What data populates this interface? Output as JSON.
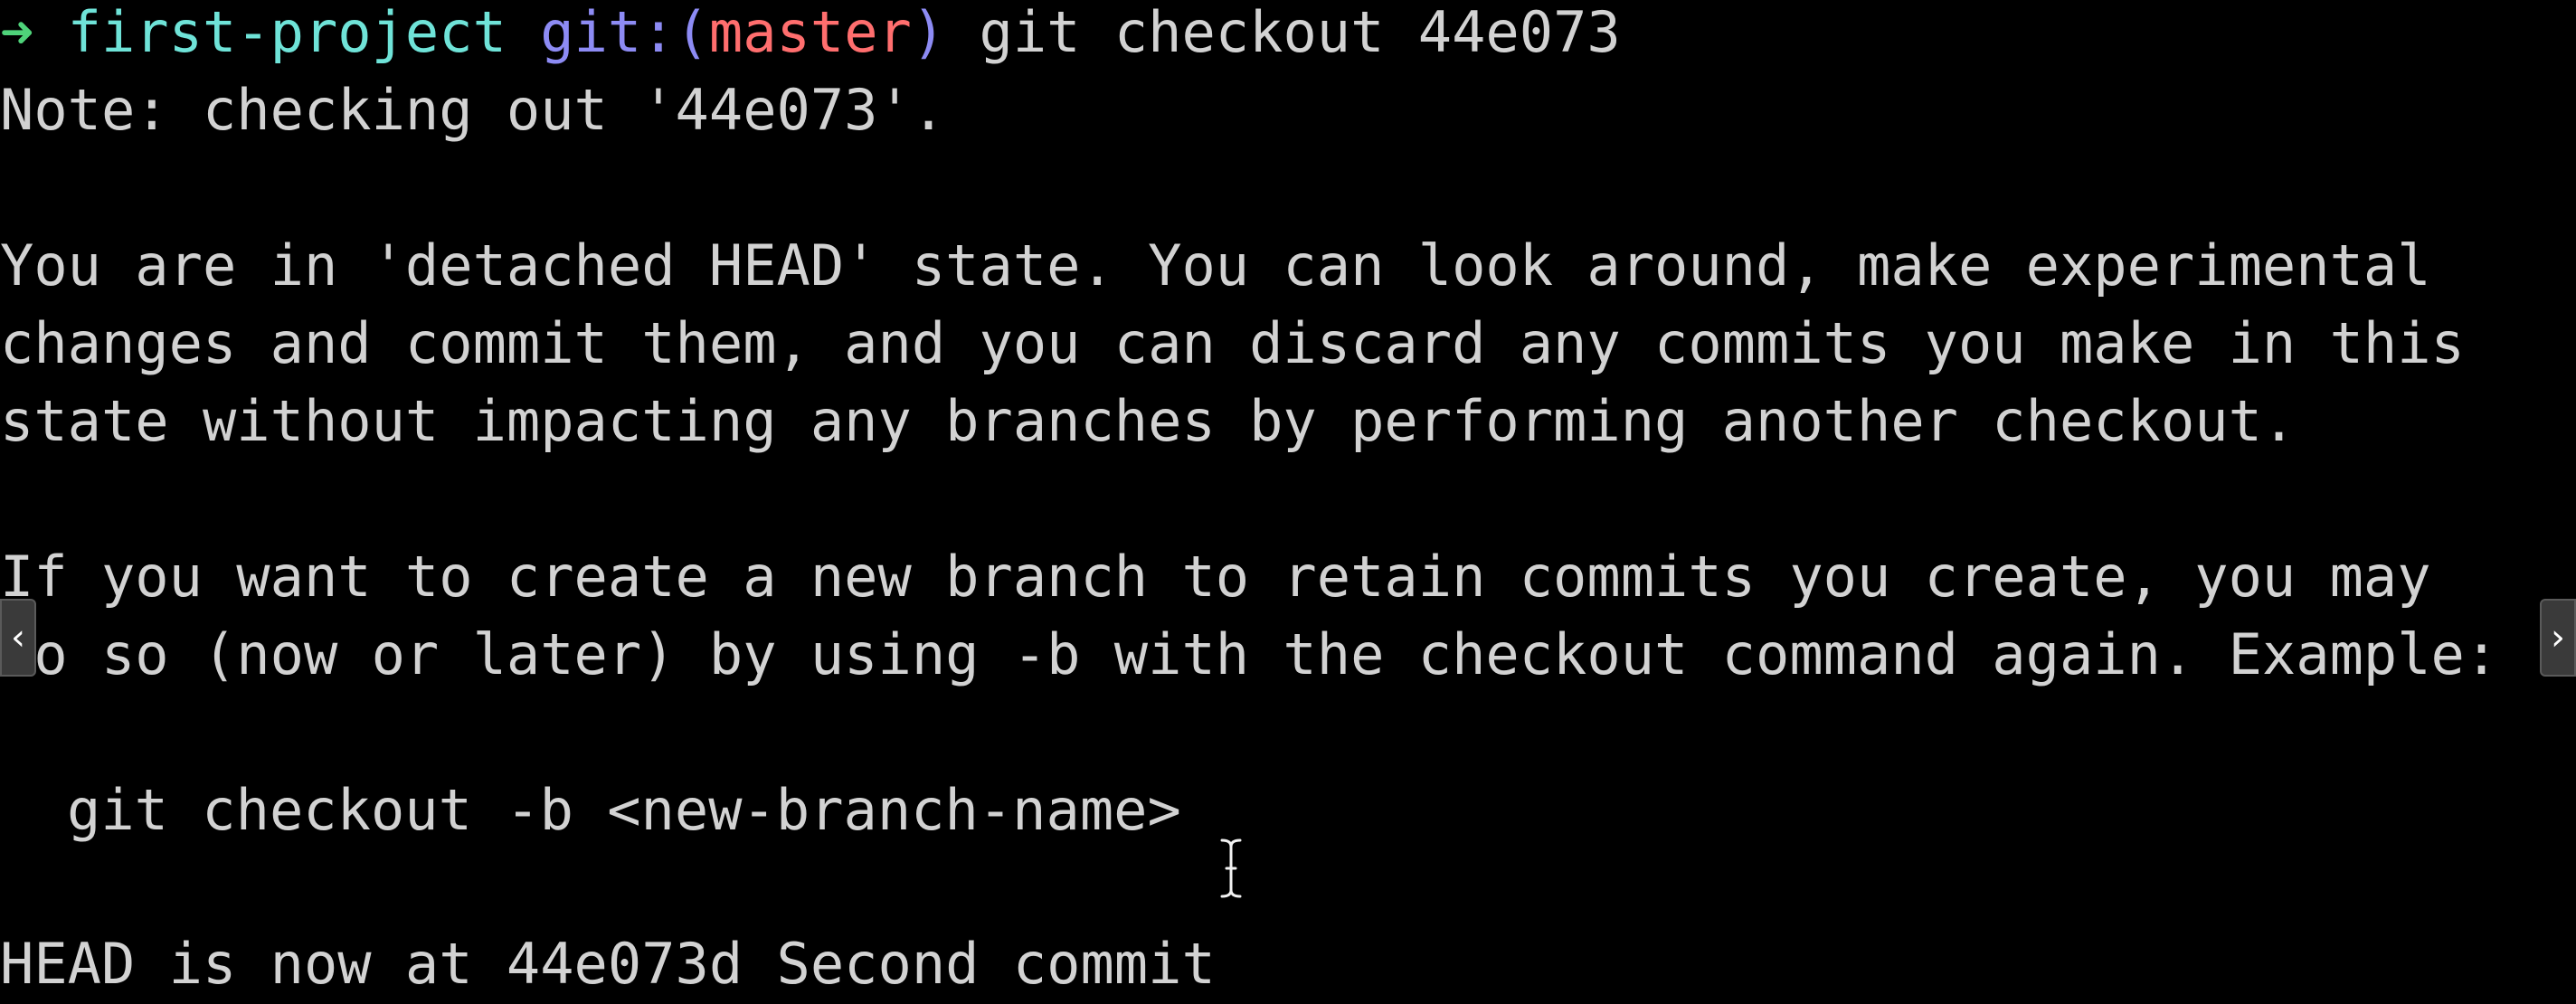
{
  "terminal": {
    "prompt": {
      "arrow": "➜",
      "directory": "first-project",
      "git_label": "git:(",
      "branch": "master",
      "git_close": ")",
      "command": "git checkout 44e073"
    },
    "output": {
      "note": "Note: checking out '44e073'.",
      "detached_1": "You are in 'detached HEAD' state. You can look around, make experimental",
      "detached_2": "changes and commit them, and you can discard any commits you make in this",
      "detached_3": "state without impacting any branches by performing another checkout.",
      "branch_hint_1": "If you want to create a new branch to retain commits you create, you may",
      "branch_hint_2": "do so (now or later) by using -b with the checkout command again. Example:",
      "example": "git checkout -b <new-branch-name>",
      "head_status": "HEAD is now at 44e073d Second commit"
    }
  },
  "nav": {
    "prev_glyph": "‹",
    "next_glyph": "›"
  },
  "colors": {
    "background": "#000000",
    "text": "#d2d2d2",
    "arrow": "#4fd37a",
    "directory": "#6fe3d8",
    "git_label": "#8d8bf4",
    "branch": "#ff6e6e"
  },
  "icons": {
    "prompt": "arrow-right-icon",
    "cursor": "text-cursor-icon",
    "prev": "chevron-left-icon",
    "next": "chevron-right-icon"
  }
}
